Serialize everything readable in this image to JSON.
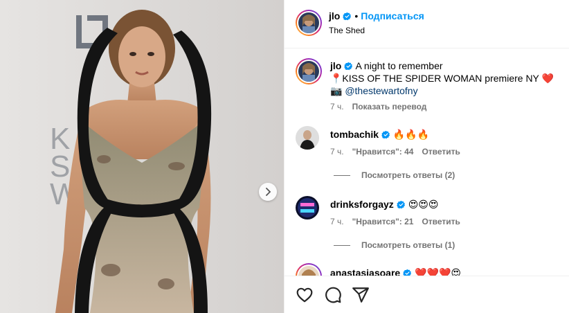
{
  "post_header": {
    "username": "jlo",
    "separator": "•",
    "follow_label": "Подписаться",
    "location": "The Shed"
  },
  "caption": {
    "username": "jlo",
    "line1": "A night to remember",
    "line2": "📍KISS OF THE SPIDER WOMAN premiere NY ❤️",
    "line3_prefix": "📷 ",
    "mention": "@thestewartofny",
    "time": "7 ч.",
    "translate_label": "Показать перевод"
  },
  "comments": [
    {
      "username": "tombachik",
      "text": "🔥🔥🔥",
      "time": "7 ч.",
      "likes": "\"Нравится\": 44",
      "reply_label": "Ответить",
      "view_replies": "Посмотреть ответы (2)"
    },
    {
      "username": "drinksforgayz",
      "text": "😍😍😍",
      "time": "7 ч.",
      "likes": "\"Нравится\": 21",
      "reply_label": "Ответить",
      "view_replies": "Посмотреть ответы (1)"
    },
    {
      "username": "anastasiasoare",
      "text": "❤️❤️❤️😍"
    }
  ],
  "icons": {
    "verified": "verified-badge-icon",
    "like": "heart-icon",
    "comment": "comment-icon",
    "share": "share-icon",
    "next": "chevron-right-icon"
  },
  "colors": {
    "accent": "#0095f6",
    "verified": "#0095f6",
    "muted": "#737373",
    "link": "#00376b",
    "border": "#efefef"
  }
}
